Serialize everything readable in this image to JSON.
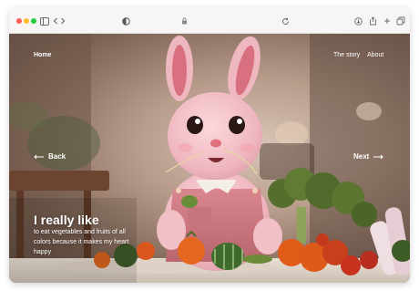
{
  "colors": {
    "close": "#ff5f57",
    "minimize": "#febc2e",
    "maximize": "#28c840"
  },
  "toolbar": {
    "icons": [
      "sidebar-icon",
      "back-icon",
      "forward-icon",
      "theme-icon",
      "lock-icon",
      "reload-icon",
      "download-icon",
      "share-icon",
      "add-tab-icon",
      "tabs-icon"
    ]
  },
  "nav": {
    "home": "Home",
    "story": "The story",
    "about": "About"
  },
  "pager": {
    "back": "Back",
    "next": "Next"
  },
  "hero": {
    "headline": "I really like",
    "body": "to eat vegetables and fruits of all colors because it makes my heart happy"
  }
}
